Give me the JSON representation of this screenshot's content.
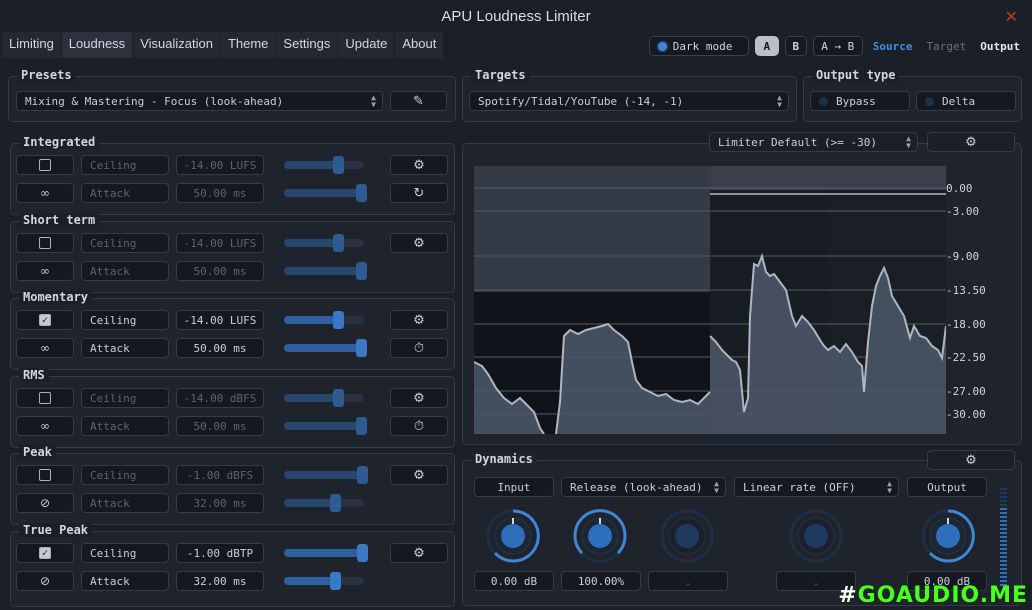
{
  "app": {
    "title": "APU Loudness Limiter"
  },
  "menu": [
    {
      "label": "Limiting"
    },
    {
      "label": "Loudness"
    },
    {
      "label": "Visualization"
    },
    {
      "label": "Theme"
    },
    {
      "label": "Settings"
    },
    {
      "label": "Update"
    },
    {
      "label": "About"
    }
  ],
  "toolbar": {
    "dark_mode": "Dark mode",
    "a": "A",
    "b": "B",
    "a_to_b": "A → B",
    "source": "Source",
    "target": "Target",
    "output": "Output"
  },
  "presets": {
    "title": "Presets",
    "value": "Mixing & Mastering - Focus (look-ahead)"
  },
  "targets": {
    "title": "Targets",
    "value": "Spotify/Tidal/YouTube (-14, -1)"
  },
  "output_type": {
    "title": "Output type",
    "bypass": "Bypass",
    "delta": "Delta"
  },
  "sections": [
    {
      "title": "Integrated",
      "enabled": false,
      "ceiling_label": "Ceiling",
      "ceiling": "-14.00 LUFS",
      "attack_label": "Attack",
      "attack": "50.00 ms",
      "ceiling_level": 0.68,
      "attack_level": 1.0
    },
    {
      "title": "Short term",
      "enabled": false,
      "ceiling_label": "Ceiling",
      "ceiling": "-14.00 LUFS",
      "attack_label": "Attack",
      "attack": "50.00 ms",
      "ceiling_level": 0.68,
      "attack_level": 1.0
    },
    {
      "title": "Momentary",
      "enabled": true,
      "ceiling_label": "Ceiling",
      "ceiling": "-14.00 LUFS",
      "attack_label": "Attack",
      "attack": "50.00 ms",
      "ceiling_level": 0.68,
      "attack_level": 1.0
    },
    {
      "title": "RMS",
      "enabled": false,
      "ceiling_label": "Ceiling",
      "ceiling": "-14.00 dBFS",
      "attack_label": "Attack",
      "attack": "50.00 ms",
      "ceiling_level": 0.68,
      "attack_level": 1.0
    },
    {
      "title": "Peak",
      "enabled": false,
      "ceiling_label": "Ceiling",
      "ceiling": "-1.00 dBFS",
      "attack_label": "Attack",
      "attack": "32.00 ms",
      "ceiling_level": 0.97,
      "attack_level": 0.64
    },
    {
      "title": "True Peak",
      "enabled": true,
      "ceiling_label": "Ceiling",
      "ceiling": "-1.00 dBTP",
      "attack_label": "Attack",
      "attack": "32.00 ms",
      "ceiling_level": 0.97,
      "attack_level": 0.64
    }
  ],
  "graph": {
    "mode": "Limiter Default (>= -30)",
    "scale": [
      "0.00",
      "-3.00",
      "-9.00",
      "-13.50",
      "-18.00",
      "-22.50",
      "-27.00",
      "-30.00"
    ]
  },
  "dynamics": {
    "title": "Dynamics",
    "input_label": "Input",
    "release_mode": "Release (look-ahead)",
    "linear_rate": "Linear rate (OFF)",
    "output_label": "Output",
    "input_value": "0.00 dB",
    "release_value": "100.00%",
    "knob3_value": ".",
    "knob4_value": ".",
    "output_value": "0.00 dB"
  },
  "watermark": {
    "prefix": "#",
    "text": "GOAUDIO.ME"
  }
}
